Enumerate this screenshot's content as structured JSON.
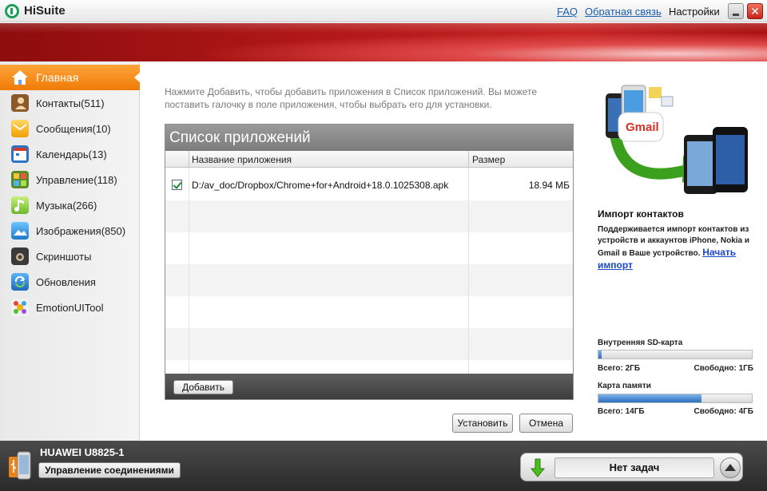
{
  "window": {
    "title": "HiSuite",
    "links": {
      "faq": "FAQ",
      "feedback": "Обратная связь",
      "settings": "Настройки"
    },
    "close_glyph": "✕"
  },
  "sidebar": {
    "items": [
      {
        "label": "Главная",
        "icon": "home-icon",
        "active": true
      },
      {
        "label": "Контакты(511)",
        "icon": "contacts-icon"
      },
      {
        "label": "Сообщения(10)",
        "icon": "messages-icon"
      },
      {
        "label": "Календарь(13)",
        "icon": "calendar-icon"
      },
      {
        "label": "Управление(118)",
        "icon": "apps-icon"
      },
      {
        "label": "Музыка(266)",
        "icon": "music-icon"
      },
      {
        "label": "Изображения(850)",
        "icon": "images-icon"
      },
      {
        "label": "Скриншоты",
        "icon": "screenshot-icon"
      },
      {
        "label": "Обновления",
        "icon": "updates-icon"
      },
      {
        "label": "EmotionUITool",
        "icon": "emotion-ui-icon"
      }
    ]
  },
  "main": {
    "intro": "Нажмите Добавить, чтобы добавить приложения в Список приложений. Вы можете поставить галочку в поле приложения, чтобы выбрать его для установки.",
    "panel_title": "Список приложений",
    "columns": {
      "name": "Название приложения",
      "size": "Размер"
    },
    "rows": [
      {
        "checked": true,
        "name": "D:/av_doc/Dropbox/Chrome+for+Android+18.0.1025308.apk",
        "size": "18.94 МБ"
      }
    ],
    "add_button": "Добавить",
    "install_button": "Установить",
    "cancel_button": "Отмена"
  },
  "right": {
    "import_title": "Импорт контактов",
    "import_text": "Поддерживается импорт контактов из устройств и аккаунтов iPhone, Nokia и Gmail в Ваше устройство.",
    "import_link": "Начать импорт",
    "gmail_label": "Gmail",
    "storage": {
      "internal": {
        "label": "Внутренняя  SD-карта",
        "total": "Всего: 2ГБ",
        "free": "Свободно: 1ГБ",
        "used_fraction": 0.02
      },
      "card": {
        "label": "Карта памяти",
        "total": "Всего: 14ГБ",
        "free": "Свободно: 4ГБ",
        "used_fraction": 0.67
      }
    }
  },
  "bottom": {
    "device_name": "HUAWEI U8825-1",
    "manage_button": "Управление соединениями",
    "task_status": "Нет задач"
  }
}
